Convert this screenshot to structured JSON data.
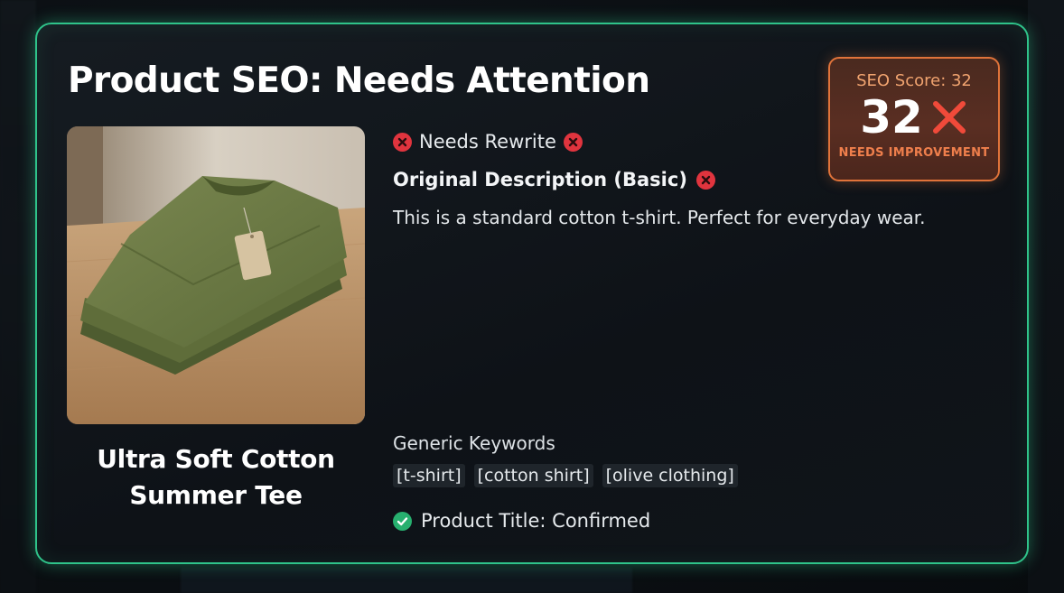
{
  "page": {
    "title": "Product SEO: Needs Attention"
  },
  "product": {
    "name_line1": "Ultra Soft Cotton",
    "name_line2": "Summer Tee",
    "image_icon": "folded-olive-tshirt-image"
  },
  "status": {
    "label": "Needs Rewrite",
    "icon": "x-circle-icon"
  },
  "description": {
    "heading": "Original Description (Basic)",
    "text": "This is a standard cotton t-shirt. Perfect for everyday wear."
  },
  "keywords": {
    "label": "Generic Keywords",
    "items": [
      "[t-shirt]",
      "[cotton shirt]",
      "[olive clothing]"
    ]
  },
  "confirmation": {
    "label": "Product Title: Confirmed",
    "icon": "check-circle-icon"
  },
  "score": {
    "label": "SEO Score: 32",
    "value": "32",
    "status": "NEEDS IMPROVEMENT",
    "value_fraction": 0.32
  },
  "colors": {
    "accent_green": "#2fc38a",
    "error_red": "#e0343e",
    "warning_orange": "#e0733a",
    "success_green": "#27b06f"
  }
}
